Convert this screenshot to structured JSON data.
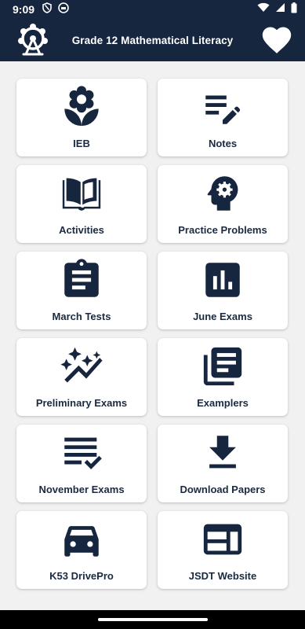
{
  "status_bar": {
    "time": "9:09",
    "icons": [
      "shield-icon",
      "media-icon",
      "wifi-icon",
      "signal-icon",
      "battery-icon"
    ]
  },
  "app_bar": {
    "title": "Grade 12 Mathematical Literacy",
    "logo_icon": "ferris-wheel-icon",
    "favorite_icon": "heart-icon",
    "background": "#17263f"
  },
  "accent_color": "#1b2a40",
  "menu": [
    {
      "label": "IEB",
      "icon": "flower-icon"
    },
    {
      "label": "Notes",
      "icon": "notes-edit-icon"
    },
    {
      "label": "Activities",
      "icon": "book-icon"
    },
    {
      "label": "Practice Problems",
      "icon": "psychology-icon"
    },
    {
      "label": "March Tests",
      "icon": "clipboard-icon"
    },
    {
      "label": "June Exams",
      "icon": "bar-chart-icon"
    },
    {
      "label": "Preliminary Exams",
      "icon": "auto-graph-icon"
    },
    {
      "label": "Examplers",
      "icon": "library-books-icon"
    },
    {
      "label": "November Exams",
      "icon": "checklist-icon"
    },
    {
      "label": "Download Papers",
      "icon": "download-icon"
    },
    {
      "label": "K53 DrivePro",
      "icon": "car-icon"
    },
    {
      "label": "JSDT Website",
      "icon": "web-layout-icon"
    }
  ]
}
